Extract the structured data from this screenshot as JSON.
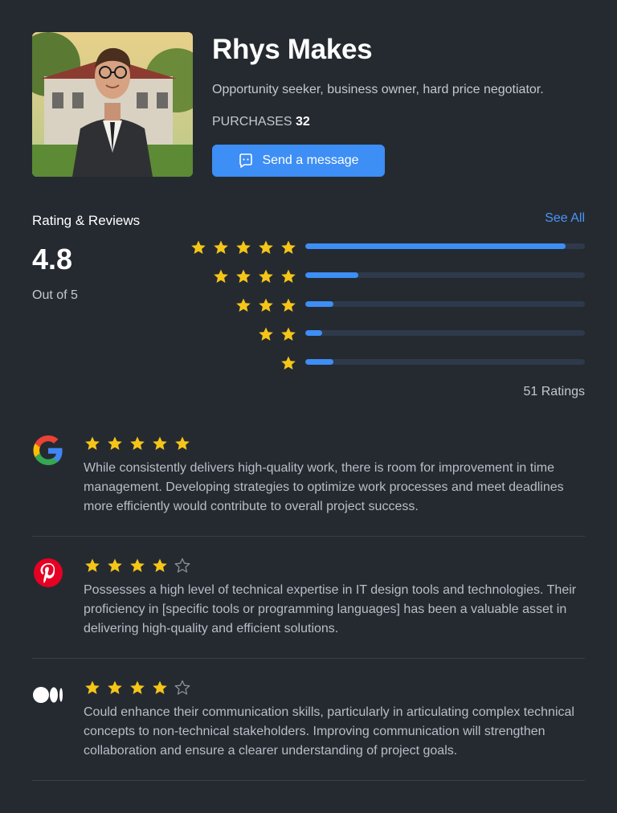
{
  "profile": {
    "name": "Rhys Makes",
    "bio": "Opportunity seeker, business owner, hard price negotiator.",
    "purchases_label": "PURCHASES",
    "purchases_count": "32",
    "message_button": "Send a message"
  },
  "ratings": {
    "title": "Rating & Reviews",
    "see_all": "See All",
    "score": "4.8",
    "out_of": "Out of 5",
    "total": "51 Ratings",
    "distribution": [
      {
        "stars": 5,
        "fraction": 0.93
      },
      {
        "stars": 4,
        "fraction": 0.19
      },
      {
        "stars": 3,
        "fraction": 0.1
      },
      {
        "stars": 2,
        "fraction": 0.06
      },
      {
        "stars": 1,
        "fraction": 0.1
      }
    ]
  },
  "reviews": [
    {
      "source_icon": "google-icon",
      "rating": 5,
      "text": "While consistently delivers high-quality work, there is room for improvement in time management. Developing strategies to optimize work processes and meet deadlines more efficiently would contribute to overall project success."
    },
    {
      "source_icon": "pinterest-icon",
      "rating": 4,
      "text": "Possesses a high level of technical expertise in IT design tools and technologies. Their proficiency in [specific tools or programming languages] has been a valuable asset in delivering high-quality and efficient solutions."
    },
    {
      "source_icon": "medium-icon",
      "rating": 4,
      "text": "Could enhance their communication skills, particularly in articulating complex technical concepts to non-technical stakeholders. Improving communication will strengthen collaboration and ensure a clearer understanding of project goals."
    }
  ],
  "colors": {
    "background": "#252a31",
    "accent": "#3d8ef5",
    "star": "#f5c518",
    "track": "#2e3a4b"
  }
}
